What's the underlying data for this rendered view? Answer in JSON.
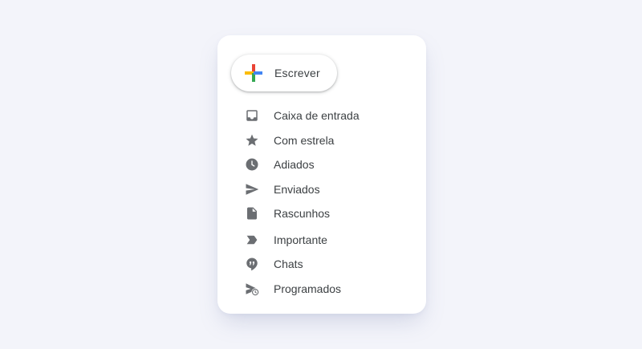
{
  "compose": {
    "label": "Escrever",
    "icon": "plus-icon",
    "colors": [
      "#ea4335",
      "#fbbc04",
      "#34a853",
      "#4285f4"
    ]
  },
  "nav": {
    "items": [
      {
        "label": "Caixa de entrada",
        "icon": "inbox-icon"
      },
      {
        "label": "Com estrela",
        "icon": "star-icon"
      },
      {
        "label": "Adiados",
        "icon": "clock-icon"
      },
      {
        "label": "Enviados",
        "icon": "send-icon"
      },
      {
        "label": "Rascunhos",
        "icon": "draft-icon"
      },
      {
        "label": "Importante",
        "icon": "label-important-icon"
      },
      {
        "label": "Chats",
        "icon": "chat-icon"
      },
      {
        "label": "Programados",
        "icon": "scheduled-send-icon"
      }
    ]
  },
  "colors": {
    "icon": "#6b6e72",
    "text": "#3c4043",
    "background": "#f3f4fa"
  }
}
